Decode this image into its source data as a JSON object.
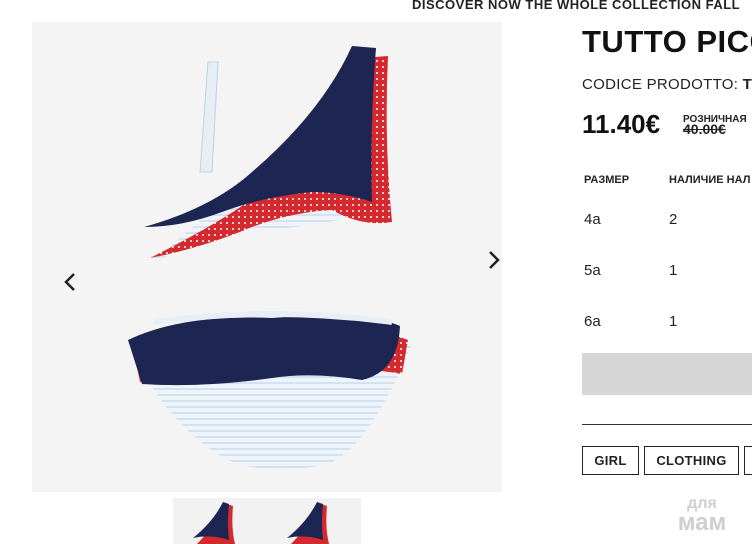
{
  "promo": {
    "text": "DISCOVER NOW THE WHOLE COLLECTION FALL"
  },
  "product": {
    "title": "TUTTO PICC",
    "code_label": "CODICE PRODOTTO:",
    "code_value": "TI",
    "price": "11.40€",
    "retail_label": "РОЗНИЧНАЯ",
    "retail_price": "40.00€"
  },
  "sizes_table": {
    "headers": {
      "size": "РАЗМЕР",
      "availability": "НАЛИЧИЕ НАЛ"
    },
    "rows": [
      {
        "size": "4a",
        "qty": "2"
      },
      {
        "size": "5a",
        "qty": "1"
      },
      {
        "size": "6a",
        "qty": "1"
      }
    ]
  },
  "tags": [
    "GIRL",
    "CLOTHING",
    ""
  ],
  "watermark": {
    "line1": "для",
    "line2": "мам"
  },
  "colors": {
    "navy": "#1d2552",
    "red": "#d42a2f",
    "stripe": "#dce8f4"
  },
  "icons": {
    "prev": "chevron-left-icon",
    "next": "chevron-right-icon"
  }
}
